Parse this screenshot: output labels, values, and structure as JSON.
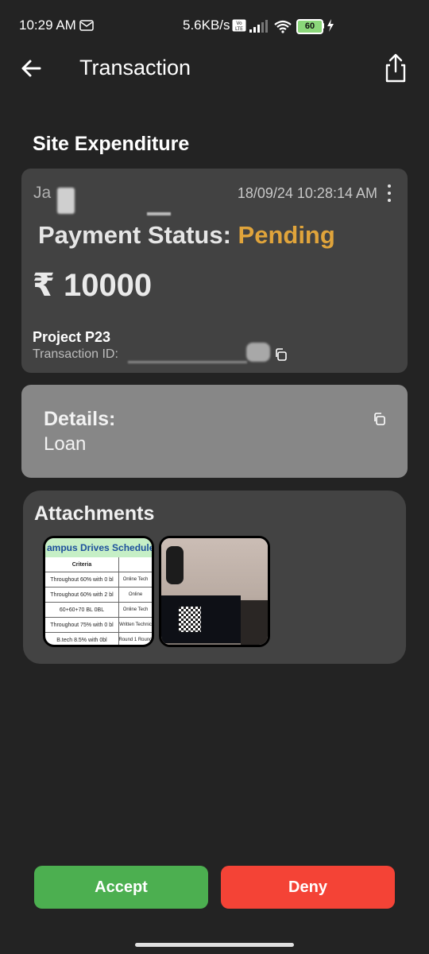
{
  "status_bar": {
    "time": "10:29 AM",
    "network_speed": "5.6KB/s",
    "battery_level": "60",
    "icons": [
      "sms-icon",
      "volte-icon",
      "signal-icon",
      "wifi-icon",
      "battery-icon",
      "charging-icon"
    ]
  },
  "app_bar": {
    "title": "Transaction",
    "back_icon": "arrow-left-icon",
    "share_icon": "share-icon"
  },
  "section_title": "Site Expenditure",
  "transaction": {
    "payer_visible": "Ja",
    "timestamp": "18/09/24 10:28:14 AM",
    "payment_status_label": "Payment Status:",
    "payment_status_value": "Pending",
    "amount": "₹ 10000",
    "project": "Project P23",
    "transaction_id_label": "Transaction ID:"
  },
  "details": {
    "label": "Details:",
    "value": "Loan"
  },
  "attachments": {
    "title": "Attachments",
    "thumb1": {
      "header": "ampus Drives Schedule",
      "col_header": "Criteria",
      "rows": [
        {
          "c1": "Throughout 60% with 0 bl",
          "c2": "Online Tech"
        },
        {
          "c1": "Throughout 60% with 2 bl",
          "c2": "Online"
        },
        {
          "c1": "60+60+70 BL 0BL",
          "c2": "Online Tech"
        },
        {
          "c1": "Throughout 75% with 0 bl",
          "c2": "Written Technic"
        },
        {
          "c1": "B.tech 8.5% with 0bl",
          "c2": "Round 1 Round"
        }
      ]
    }
  },
  "actions": {
    "accept": "Accept",
    "deny": "Deny"
  },
  "colors": {
    "background": "#232323",
    "card": "#424242",
    "details_card": "#878787",
    "pending": "#e0a43b",
    "accept": "#4caf50",
    "deny": "#f44336"
  }
}
